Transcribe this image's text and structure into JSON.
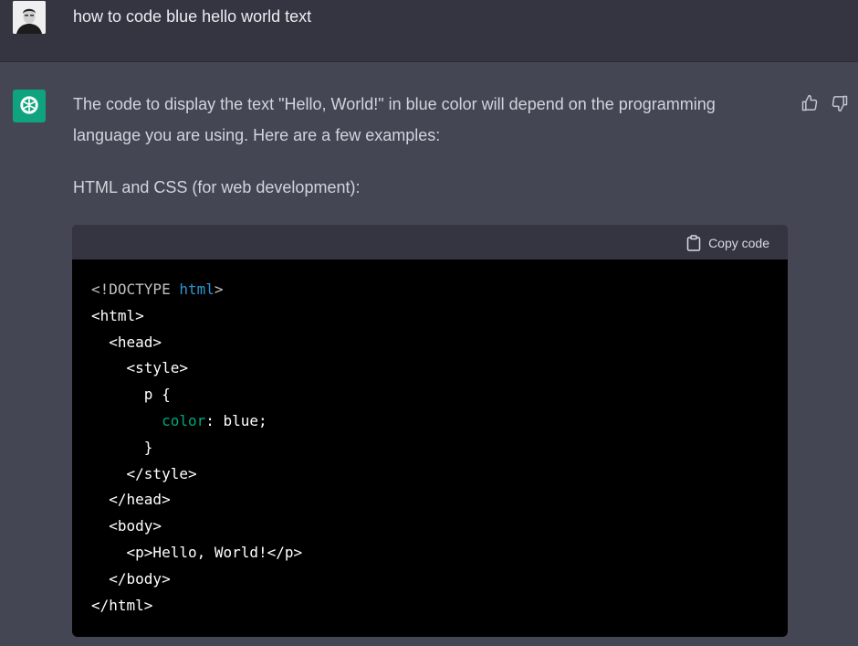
{
  "user_message": {
    "text": "how to code blue hello world text"
  },
  "assistant_message": {
    "paragraph_1": "The code to display the text \"Hello, World!\" in blue color will depend on the programming language you are using. Here are a few examples:",
    "paragraph_2": "HTML and CSS (for web development):",
    "code_block": {
      "copy_label": "Copy code",
      "lines": [
        {
          "indent": "",
          "parts": [
            {
              "t": "<!DOCTYPE ",
              "c": "decl"
            },
            {
              "t": "html",
              "c": "keyword"
            },
            {
              "t": ">",
              "c": "decl"
            }
          ]
        },
        {
          "indent": "",
          "parts": [
            {
              "t": "<html>",
              "c": "plain"
            }
          ]
        },
        {
          "indent": "  ",
          "parts": [
            {
              "t": "<head>",
              "c": "plain"
            }
          ]
        },
        {
          "indent": "    ",
          "parts": [
            {
              "t": "<style>",
              "c": "plain"
            }
          ]
        },
        {
          "indent": "      ",
          "parts": [
            {
              "t": "p {",
              "c": "plain"
            }
          ]
        },
        {
          "indent": "        ",
          "parts": [
            {
              "t": "color",
              "c": "prop"
            },
            {
              "t": ": blue;",
              "c": "plain"
            }
          ]
        },
        {
          "indent": "      ",
          "parts": [
            {
              "t": "}",
              "c": "plain"
            }
          ]
        },
        {
          "indent": "    ",
          "parts": [
            {
              "t": "</style>",
              "c": "plain"
            }
          ]
        },
        {
          "indent": "  ",
          "parts": [
            {
              "t": "</head>",
              "c": "plain"
            }
          ]
        },
        {
          "indent": "  ",
          "parts": [
            {
              "t": "<body>",
              "c": "plain"
            }
          ]
        },
        {
          "indent": "    ",
          "parts": [
            {
              "t": "<p>Hello, World!</p>",
              "c": "plain"
            }
          ]
        },
        {
          "indent": "  ",
          "parts": [
            {
              "t": "</body>",
              "c": "plain"
            }
          ]
        },
        {
          "indent": "",
          "parts": [
            {
              "t": "</html>",
              "c": "plain"
            }
          ]
        }
      ]
    }
  },
  "icons": {
    "user_avatar": "user-avatar-photo",
    "bot_avatar": "openai-logo-icon",
    "thumb_up": "thumbs-up-icon",
    "thumb_down": "thumbs-down-icon",
    "copy": "clipboard-icon"
  },
  "colors": {
    "user_row_bg": "#343541",
    "assistant_row_bg": "#444654",
    "bot_avatar_bg": "#10a37f",
    "code_bg": "#000000",
    "code_header_bg": "#343541",
    "syntax_keyword": "#2e95d3",
    "syntax_property": "#00a67d"
  }
}
